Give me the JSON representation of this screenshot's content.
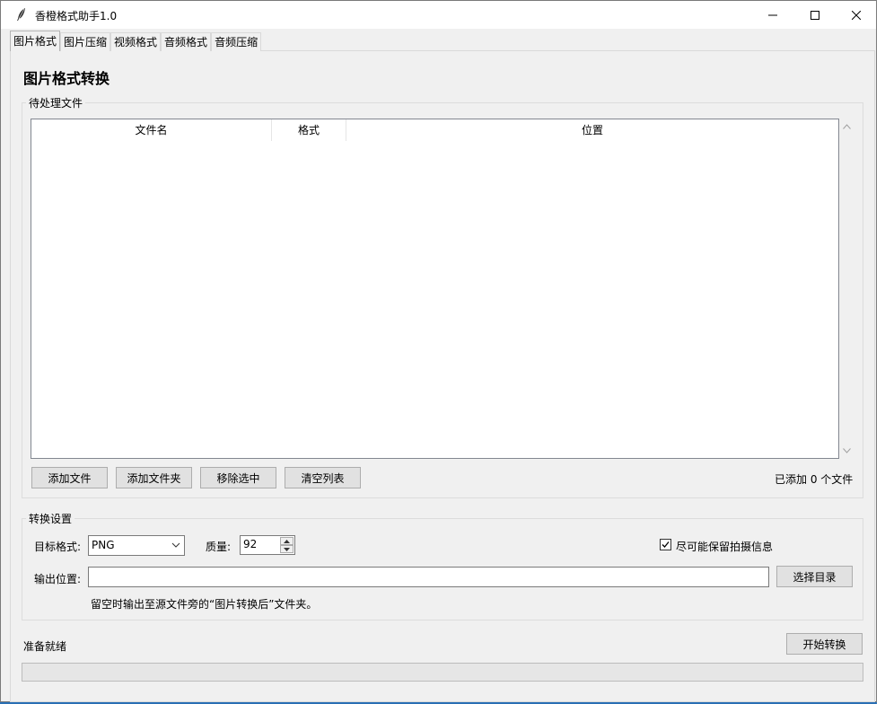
{
  "window": {
    "title": "香橙格式助手1.0"
  },
  "tabs": [
    {
      "label": "图片格式",
      "active": true
    },
    {
      "label": "图片压缩",
      "active": false
    },
    {
      "label": "视频格式",
      "active": false
    },
    {
      "label": "音频格式",
      "active": false
    },
    {
      "label": "音频压缩",
      "active": false
    }
  ],
  "page": {
    "title": "图片格式转换"
  },
  "files_group": {
    "label": "待处理文件",
    "columns": [
      "文件名",
      "格式",
      "位置"
    ],
    "rows": [],
    "buttons": {
      "add_file": "添加文件",
      "add_folder": "添加文件夹",
      "remove_selected": "移除选中",
      "clear_list": "清空列表"
    },
    "count_text": "已添加 0 个文件"
  },
  "settings_group": {
    "label": "转换设置",
    "target_format_label": "目标格式:",
    "target_format_value": "PNG",
    "quality_label": "质量:",
    "quality_value": "92",
    "keep_exif_label": "尽可能保留拍摄信息",
    "keep_exif_checked": true,
    "output_label": "输出位置:",
    "output_value": "",
    "choose_dir": "选择目录",
    "hint": "留空时输出至源文件旁的“图片转换后”文件夹。"
  },
  "footer": {
    "status": "准备就绪",
    "start_button": "开始转换",
    "progress": 0
  }
}
